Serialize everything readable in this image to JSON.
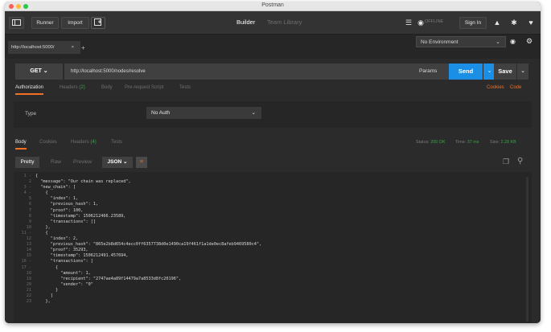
{
  "window": {
    "title": "Postman"
  },
  "header": {
    "runner": "Runner",
    "import": "Import",
    "tabs": [
      "Builder",
      "Team Library"
    ],
    "sync_status": "OFFLINE",
    "signin": "Sign In"
  },
  "request_tab": {
    "title": "http://localhost:5000/",
    "close": "×",
    "add": "+"
  },
  "environment": {
    "selected": "No Environment"
  },
  "request": {
    "method": "GET",
    "url": "http://localhost:5000/nodes/resolve",
    "params": "Params",
    "send": "Send",
    "save": "Save"
  },
  "request_tabs": {
    "authorization": "Authorization",
    "headers": "Headers",
    "headers_count": "(2)",
    "body": "Body",
    "prerequest": "Pre-request Script",
    "tests": "Tests",
    "cookies": "Cookies",
    "code": "Code"
  },
  "auth": {
    "type_label": "Type",
    "type_value": "No Auth"
  },
  "response_tabs": {
    "body": "Body",
    "cookies": "Cookies",
    "headers": "Headers",
    "headers_count": "(4)",
    "tests": "Tests"
  },
  "status": {
    "status_label": "Status:",
    "status_value": "200 OK",
    "time_label": "Time:",
    "time_value": "37 ms",
    "size_label": "Size:",
    "size_value": "2.28 KB"
  },
  "view": {
    "pretty": "Pretty",
    "raw": "Raw",
    "preview": "Preview",
    "format": "JSON"
  },
  "code_lines": [
    {
      "n": "1 -",
      "t": "{"
    },
    {
      "n": "2",
      "t": "  \"message\": \"Our chain was replaced\","
    },
    {
      "n": "3 -",
      "t": "  \"new_chain\": ["
    },
    {
      "n": "4 -",
      "t": "    {"
    },
    {
      "n": "5",
      "t": "      \"index\": 1,"
    },
    {
      "n": "6",
      "t": "      \"previous_hash\": 1,"
    },
    {
      "n": "7",
      "t": "      \"proof\": 100,"
    },
    {
      "n": "8",
      "t": "      \"timestamp\": 1506212466.23589,"
    },
    {
      "n": "9",
      "t": "      \"transactions\": []"
    },
    {
      "n": "10",
      "t": "    },"
    },
    {
      "n": "11 -",
      "t": "    {"
    },
    {
      "n": "12",
      "t": "      \"index\": 2,"
    },
    {
      "n": "13",
      "t": "      \"previous_hash\": \"865e2b8d654c4ecc0ff6357738d0e1490ca19f461f1a1de0ec8afeb9469580c4\","
    },
    {
      "n": "14",
      "t": "      \"proof\": 35293,"
    },
    {
      "n": "15",
      "t": "      \"timestamp\": 1506212491.457694,"
    },
    {
      "n": "16 -",
      "t": "      \"transactions\": ["
    },
    {
      "n": "17 -",
      "t": "        {"
    },
    {
      "n": "18",
      "t": "          \"amount\": 1,"
    },
    {
      "n": "19",
      "t": "          \"recipient\": \"2747ae4a89f14479a7a8533d8fc20196\","
    },
    {
      "n": "20",
      "t": "          \"sender\": \"0\""
    },
    {
      "n": "21",
      "t": "        }"
    },
    {
      "n": "22",
      "t": "      ]"
    },
    {
      "n": "23",
      "t": "    },"
    }
  ],
  "colors": {
    "accent": "#f47023",
    "send": "#1a8fe5",
    "status_ok": "#3fa14a",
    "background": "#2b2b2b"
  }
}
